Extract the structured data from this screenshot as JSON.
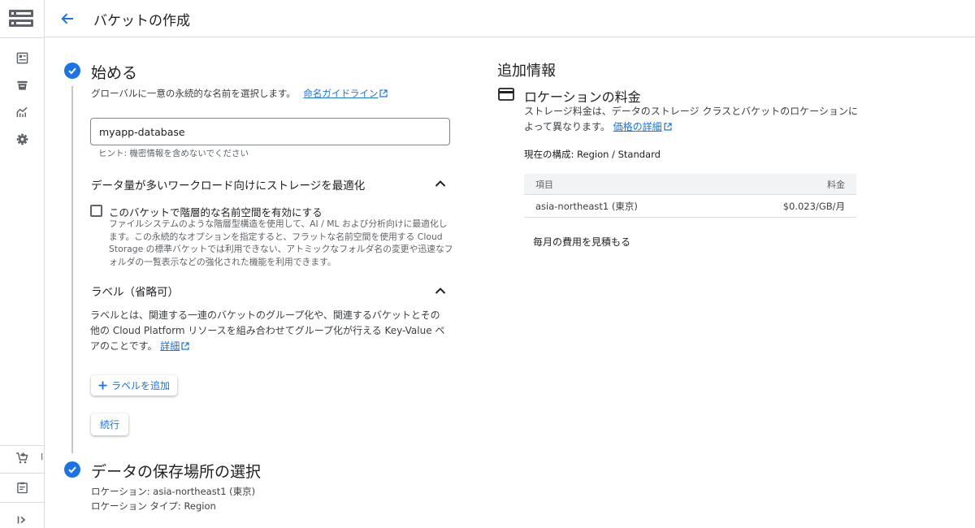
{
  "header": {
    "title": "バケットの作成"
  },
  "rail": {
    "peek_text": "I",
    "icons": [
      "storage-logo-icon",
      "dashboard-icon",
      "bucket-icon",
      "monitoring-icon",
      "settings-icon",
      "marketplace-icon",
      "release-notes-icon",
      "expand-rail-icon"
    ]
  },
  "step1": {
    "title": "始める",
    "desc": "グローバルに一意の永続的な名前を選択します。",
    "guide_link": "命名ガイドライン",
    "name_value": "myapp-database",
    "hint": "ヒント: 機密情報を含めないでください",
    "optimize": {
      "heading": "データ量が多いワークロード向けにストレージを最適化",
      "checkbox_label": "このバケットで階層的な名前空間を有効にする",
      "checkbox_desc": "ファイルシステムのような階層型構造を使用して、AI / ML および分析向けに最適化します。この永続的なオプションを指定すると、フラットな名前空間を使用する Cloud Storage の標準バケットでは利用できない、アトミックなフォルダ名の変更や迅速なフォルダの一覧表示などの強化された機能を利用できます。",
      "checked": false
    },
    "labels": {
      "heading": "ラベル（省略可）",
      "desc": "ラベルとは、関連する一連のバケットのグループ化や、関連するバケットとその他の Cloud Platform リソースを組み合わせてグループ化が行える Key-Value ペアのことです。",
      "detail_link": "詳細",
      "add_button": "ラベルを追加"
    },
    "continue_button": "続行"
  },
  "step2": {
    "title": "データの保存場所の選択",
    "location": "ロケーション: asia-northeast1 (東京)",
    "location_type": "ロケーション タイプ: Region"
  },
  "right": {
    "title": "追加情報",
    "subtitle": "ロケーションの料金",
    "desc": "ストレージ料金は、データのストレージ クラスとバケットのロケーションによって異なります。",
    "price_link": "価格の詳細",
    "current_config": "現在の構成: Region / Standard",
    "table": {
      "col_item": "項目",
      "col_price": "料金",
      "rows": [
        {
          "item": "asia-northeast1 (東京)",
          "price": "$0.023/GB/月"
        }
      ]
    },
    "estimate": "毎月の費用を見積もる"
  },
  "colors": {
    "accent": "#1a73e8",
    "text": "#202124",
    "muted": "#5f6368",
    "border": "#dadce0"
  }
}
